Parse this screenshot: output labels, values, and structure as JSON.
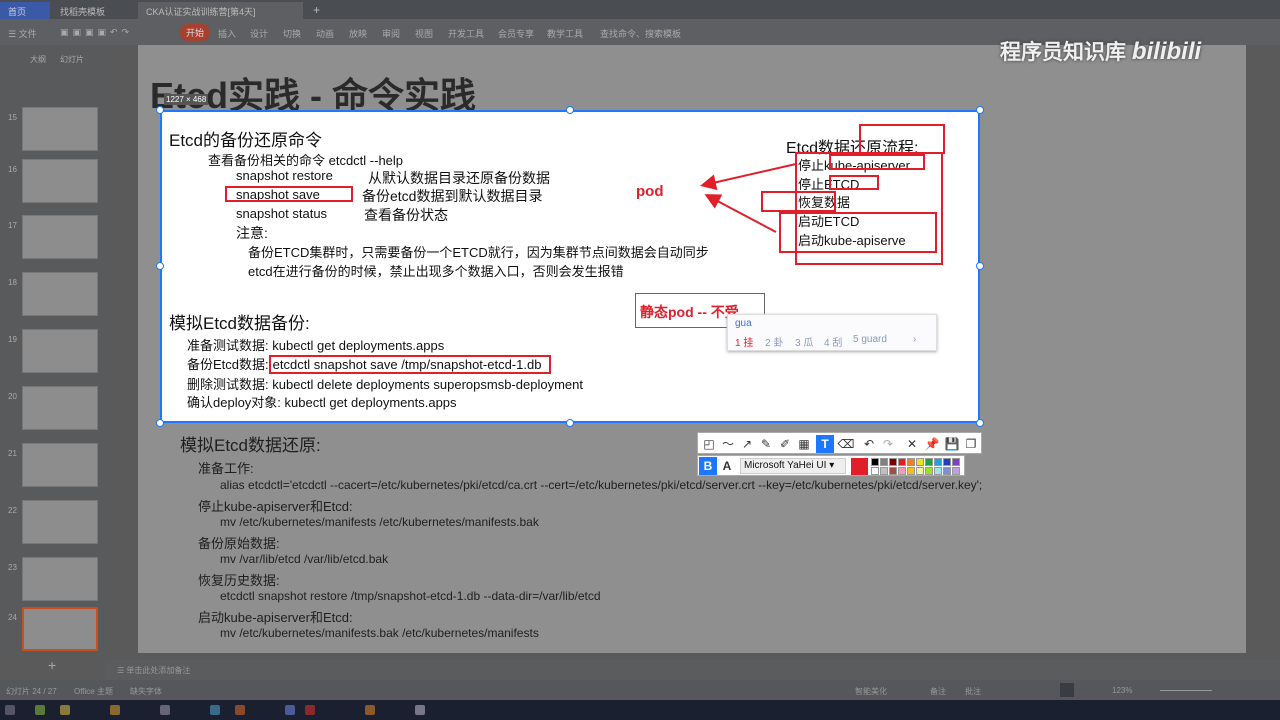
{
  "tabs": [
    {
      "label": "首页"
    },
    {
      "label": "找稻壳模板"
    },
    {
      "label": "CKA认证实战训练营[第4天]"
    }
  ],
  "ribbon": {
    "file": "文件",
    "menus": [
      "开始",
      "插入",
      "设计",
      "切换",
      "动画",
      "放映",
      "审阅",
      "视图",
      "开发工具",
      "会员专享",
      "教学工具"
    ],
    "search": "查找命令、搜索模板"
  },
  "panel": {
    "outline": "大纲",
    "slides": "幻灯片",
    "numbers": [
      "15",
      "16",
      "17",
      "18",
      "19",
      "20",
      "21",
      "22",
      "23",
      "24"
    ]
  },
  "watermark": {
    "text": "程序员知识库",
    "logo": "bilibili"
  },
  "slide": {
    "title": "Etcd实践 - 命令实践",
    "size_label": "1227 × 468",
    "heading1": "Etcd的备份还原命令",
    "help_line": "查看备份相关的命令   etcdctl --help",
    "cmds": [
      {
        "cmd": "snapshot restore",
        "desc": "从默认数据目录还原备份数据"
      },
      {
        "cmd": "snapshot save",
        "desc": "备份etcd数据到默认数据目录"
      },
      {
        "cmd": "snapshot status",
        "desc": "查看备份状态"
      }
    ],
    "note_label": "注意:",
    "notes": [
      "备份ETCD集群时，只需要备份一个ETCD就行，因为集群节点间数据会自动同步",
      "etcd在进行备份的时候，禁止出现多个数据入口，否则会发生报错"
    ],
    "restore_flow_title": "Etcd数据还原流程:",
    "restore_flow": [
      "停止kube-apiserver",
      "停止ETCD",
      "恢复数据",
      "启动ETCD",
      "启动kube-apiserve"
    ],
    "pod_label": "pod",
    "static_pod": "静态pod -- 不受",
    "heading2": "模拟Etcd数据备份:",
    "backup_steps": [
      {
        "label": "准备测试数据:",
        "cmd": " kubectl get deployments.apps"
      },
      {
        "label": "备份Etcd数据:",
        "cmd": "etcdctl snapshot save /tmp/snapshot-etcd-1.db"
      },
      {
        "label": "删除测试数据:",
        "cmd": " kubectl delete deployments superopsmsb-deployment"
      },
      {
        "label": "确认deploy对象:",
        "cmd": " kubectl  get deployments.apps"
      }
    ],
    "heading3": "模拟Etcd数据还原:",
    "restore_steps": [
      "准备工作:",
      "alias etcdctl='etcdctl --cacert=/etc/kubernetes/pki/etcd/ca.crt --cert=/etc/kubernetes/pki/etcd/server.crt --key=/etc/kubernetes/pki/etcd/server.key';",
      "停止kube-apiserver和Etcd:",
      "mv /etc/kubernetes/manifests /etc/kubernetes/manifests.bak",
      "备份原始数据:",
      "mv /var/lib/etcd /var/lib/etcd.bak",
      "恢复历史数据:",
      "etcdctl snapshot restore /tmp/snapshot-etcd-1.db --data-dir=/var/lib/etcd",
      "启动kube-apiserver和Etcd:",
      "mv /etc/kubernetes/manifests.bak /etc/kubernetes/manifests"
    ]
  },
  "ime": {
    "input": "gua",
    "candidates": [
      "1 挂",
      "2 卦",
      "3 瓜",
      "4 刮",
      "5 guard"
    ]
  },
  "annot_toolbar": {
    "font": "Microsoft YaHei UI",
    "colors": [
      "#000000",
      "#808080",
      "#800000",
      "#e01f2a",
      "#f08020",
      "#f0e020",
      "#20a040",
      "#20a0e0",
      "#2040c0",
      "#8040c0",
      "#ffffff",
      "#c0c0c0",
      "#a05040",
      "#f0a0b0",
      "#f0c020",
      "#f0f0a0",
      "#a0e020",
      "#a0e0f0",
      "#8090d0",
      "#c0a0e0"
    ],
    "current_color": "#e01f2a"
  },
  "status": {
    "slide": "幻灯片 24 / 27",
    "theme": "Office 主题",
    "font": "缺失字体",
    "notes_hint": "单击此处添加备注",
    "smart": "智能美化",
    "notes": "备注",
    "comments": "批注",
    "zoom": "123%"
  }
}
